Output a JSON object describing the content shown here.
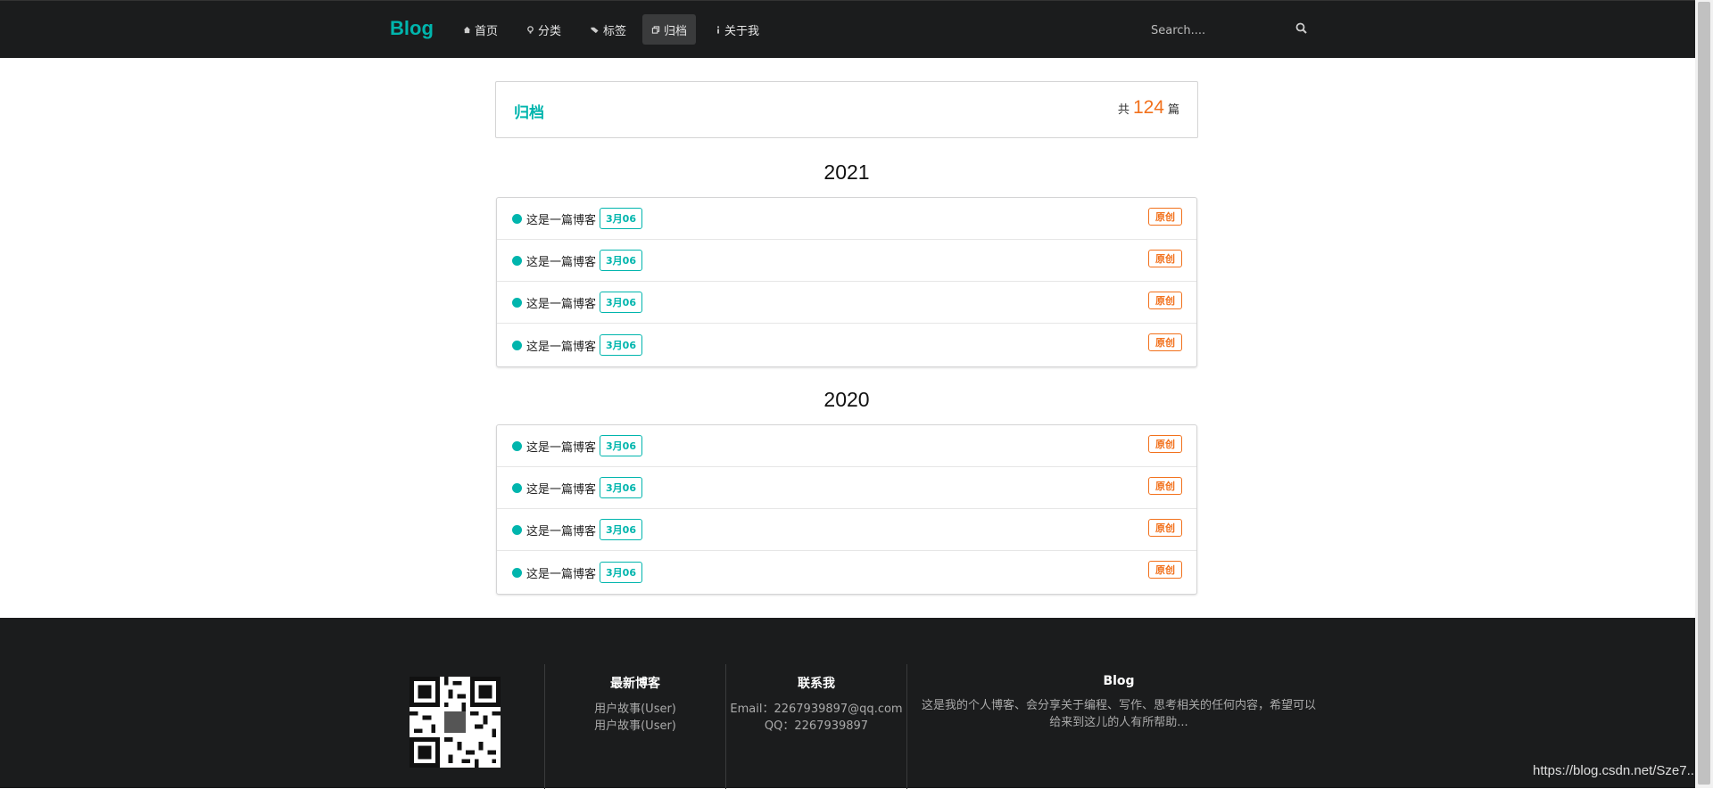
{
  "nav": {
    "brand": "Blog",
    "items": [
      {
        "label": "首页",
        "icon": "home-icon"
      },
      {
        "label": "分类",
        "icon": "idea-icon"
      },
      {
        "label": "标签",
        "icon": "tags-icon"
      },
      {
        "label": "归档",
        "icon": "clone-icon",
        "active": true
      },
      {
        "label": "关于我",
        "icon": "info-icon"
      }
    ],
    "search_placeholder": "Search...."
  },
  "archive": {
    "title": "归档",
    "count_prefix": "共",
    "count": "124",
    "count_suffix": "篇"
  },
  "years": [
    {
      "year": "2021",
      "posts": [
        {
          "title": "这是一篇博客",
          "date": "3月06",
          "type": "原创"
        },
        {
          "title": "这是一篇博客",
          "date": "3月06",
          "type": "原创"
        },
        {
          "title": "这是一篇博客",
          "date": "3月06",
          "type": "原创"
        },
        {
          "title": "这是一篇博客",
          "date": "3月06",
          "type": "原创"
        }
      ]
    },
    {
      "year": "2020",
      "posts": [
        {
          "title": "这是一篇博客",
          "date": "3月06",
          "type": "原创"
        },
        {
          "title": "这是一篇博客",
          "date": "3月06",
          "type": "原创"
        },
        {
          "title": "这是一篇博客",
          "date": "3月06",
          "type": "原创"
        },
        {
          "title": "这是一篇博客",
          "date": "3月06",
          "type": "原创"
        }
      ]
    }
  ],
  "footer": {
    "latest": {
      "title": "最新博客",
      "items": [
        "用户故事(User)",
        "用户故事(User)"
      ]
    },
    "contact": {
      "title": "联系我",
      "email": "Email：2267939897@qq.com",
      "qq": "QQ：2267939897"
    },
    "about": {
      "title": "Blog",
      "text": "这是我的个人博客、会分享关于编程、写作、思考相关的任何内容，希望可以给来到这儿的人有所帮助..."
    }
  },
  "watermark": "https://blog.csdn.net/Sze7..",
  "colors": {
    "accent": "#00b5ad",
    "orange": "#f2711c",
    "dark": "#1b1c1d"
  }
}
